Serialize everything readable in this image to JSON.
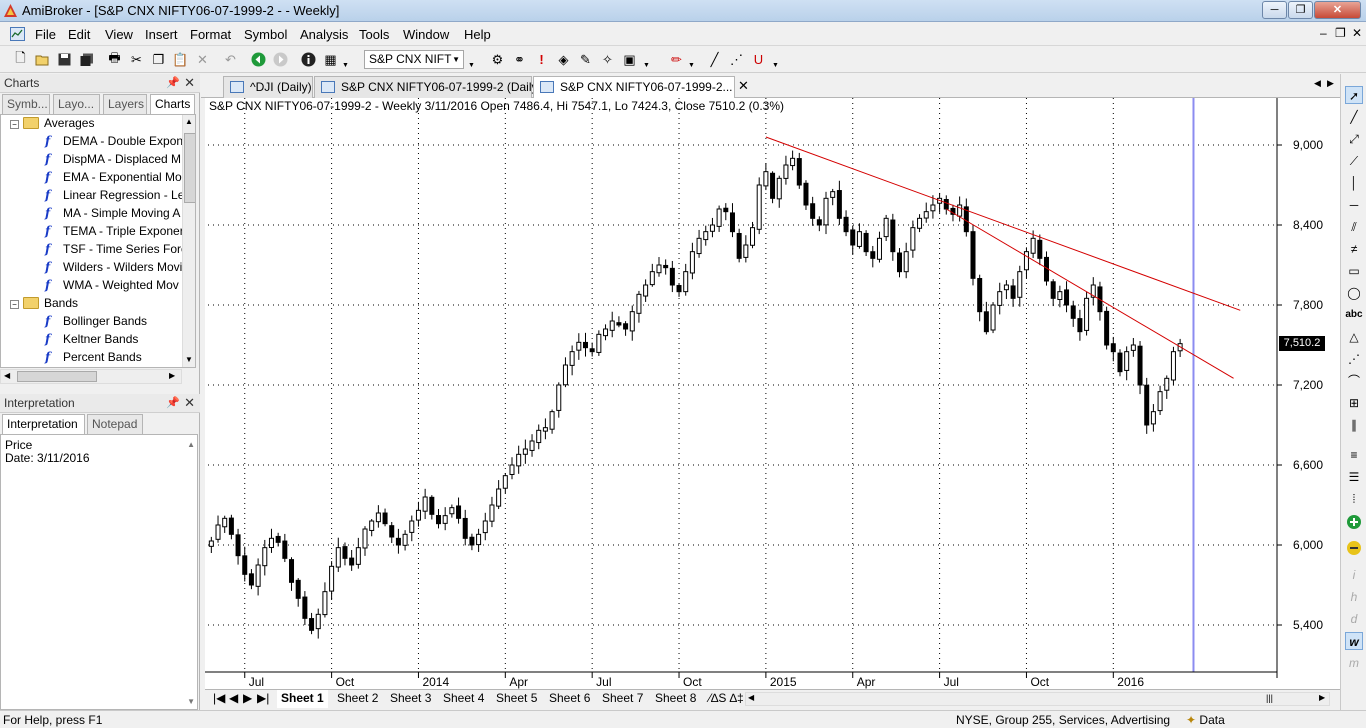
{
  "window": {
    "title": "AmiBroker - [S&P CNX NIFTY06-07-1999-2 -  - Weekly]",
    "controls": [
      "─",
      "❐",
      "✕"
    ]
  },
  "menu": [
    "File",
    "Edit",
    "View",
    "Insert",
    "Format",
    "Symbol",
    "Analysis",
    "Tools",
    "Window",
    "Help"
  ],
  "mdi_controls": [
    "–",
    "❐",
    "✕"
  ],
  "toolbar": {
    "symbol_combo": "S&P CNX NIFT"
  },
  "charts_panel": {
    "title": "Charts",
    "tabs": [
      "Symb...",
      "Layo...",
      "Layers",
      "Charts"
    ],
    "tree": [
      {
        "type": "folder",
        "label": "Averages"
      },
      {
        "type": "formula",
        "label": "DEMA - Double Exponen"
      },
      {
        "type": "formula",
        "label": "DispMA - Displaced M"
      },
      {
        "type": "formula",
        "label": "EMA - Exponential Mo"
      },
      {
        "type": "formula",
        "label": "Linear Regression - Lea"
      },
      {
        "type": "formula",
        "label": "MA - Simple Moving A"
      },
      {
        "type": "formula",
        "label": "TEMA - Triple Exponer"
      },
      {
        "type": "formula",
        "label": "TSF - Time Series Fore"
      },
      {
        "type": "formula",
        "label": "Wilders - Wilders Movi"
      },
      {
        "type": "formula",
        "label": "WMA - Weighted Mov"
      },
      {
        "type": "folder",
        "label": "Bands"
      },
      {
        "type": "formula",
        "label": "Bollinger Bands"
      },
      {
        "type": "formula",
        "label": "Keltner Bands"
      },
      {
        "type": "formula",
        "label": "Percent Bands"
      }
    ]
  },
  "interpretation_panel": {
    "title": "Interpretation",
    "tabs": [
      "Interpretation",
      "Notepad"
    ],
    "line1": "Price",
    "line2": "Date: 3/11/2016"
  },
  "doc_tabs": [
    "^DJI (Daily)",
    "S&P CNX NIFTY06-07-1999-2 (Daily)",
    "S&P CNX NIFTY06-07-1999-2..."
  ],
  "chart": {
    "header": "S&P CNX NIFTY06-07-1999-2 - Weekly 3/11/2016 Open 7486.4, Hi 7547.1, Lo 7424.3, Close 7510.2 (0.3%)",
    "last_price_label": "7,510.2",
    "last_price": 7510.2,
    "y_ticks": [
      {
        "value": 9000,
        "label": "9,000"
      },
      {
        "value": 8400,
        "label": "8,400"
      },
      {
        "value": 7800,
        "label": "7,800"
      },
      {
        "value": 7200,
        "label": "7,200"
      },
      {
        "value": 6600,
        "label": "6,600"
      },
      {
        "value": 6000,
        "label": "6,000"
      },
      {
        "value": 5400,
        "label": "5,400"
      }
    ],
    "x_ticks": [
      {
        "week": 5,
        "label": "Jul"
      },
      {
        "week": 18,
        "label": "Oct"
      },
      {
        "week": 31,
        "label": "2014",
        "major": true
      },
      {
        "week": 44,
        "label": "Apr"
      },
      {
        "week": 57,
        "label": "Jul"
      },
      {
        "week": 70,
        "label": "Oct"
      },
      {
        "week": 83,
        "label": "2015",
        "major": true
      },
      {
        "week": 96,
        "label": "Apr"
      },
      {
        "week": 109,
        "label": "Jul"
      },
      {
        "week": 122,
        "label": "Oct"
      },
      {
        "week": 135,
        "label": "2016",
        "major": true
      }
    ]
  },
  "chart_data": {
    "type": "candlestick",
    "title": "S&P CNX NIFTY06-07-1999-2 - Weekly",
    "ylim": [
      5150,
      9350
    ],
    "x_count": 160,
    "grid": true,
    "closes": [
      6030,
      6150,
      6200,
      6080,
      5920,
      5780,
      5700,
      5850,
      5980,
      6050,
      6020,
      5900,
      5720,
      5600,
      5450,
      5360,
      5480,
      5650,
      5840,
      5980,
      5900,
      5850,
      5980,
      6120,
      6180,
      6240,
      6160,
      6060,
      6000,
      6080,
      6180,
      6260,
      6360,
      6230,
      6160,
      6220,
      6280,
      6200,
      6050,
      6000,
      6080,
      6180,
      6300,
      6420,
      6520,
      6600,
      6680,
      6720,
      6780,
      6860,
      6880,
      7000,
      7200,
      7350,
      7450,
      7520,
      7480,
      7450,
      7580,
      7620,
      7680,
      7650,
      7620,
      7750,
      7880,
      7950,
      8050,
      8100,
      8080,
      7950,
      7900,
      8050,
      8200,
      8300,
      8350,
      8400,
      8520,
      8500,
      8350,
      8150,
      8250,
      8380,
      8700,
      8800,
      8600,
      8750,
      8850,
      8900,
      8700,
      8550,
      8450,
      8400,
      8600,
      8650,
      8450,
      8350,
      8250,
      8350,
      8200,
      8150,
      8300,
      8450,
      8200,
      8050,
      8200,
      8380,
      8450,
      8500,
      8550,
      8600,
      8520,
      8480,
      8550,
      8350,
      8000,
      7750,
      7600,
      7800,
      7900,
      7950,
      7850,
      8050,
      8200,
      8300,
      8150,
      7980,
      7850,
      7900,
      7800,
      7700,
      7600,
      7850,
      7950,
      7750,
      7500,
      7450,
      7300,
      7450,
      7500,
      7200,
      6900,
      7000,
      7150,
      7250,
      7450,
      7510
    ],
    "trendlines": [
      {
        "from": {
          "week": 83,
          "price": 9060
        },
        "to": {
          "week": 154,
          "price": 7760
        }
      },
      {
        "from": {
          "week": 110,
          "price": 8520
        },
        "to": {
          "week": 153,
          "price": 7250
        }
      }
    ],
    "cursor_week": 147
  }
}
